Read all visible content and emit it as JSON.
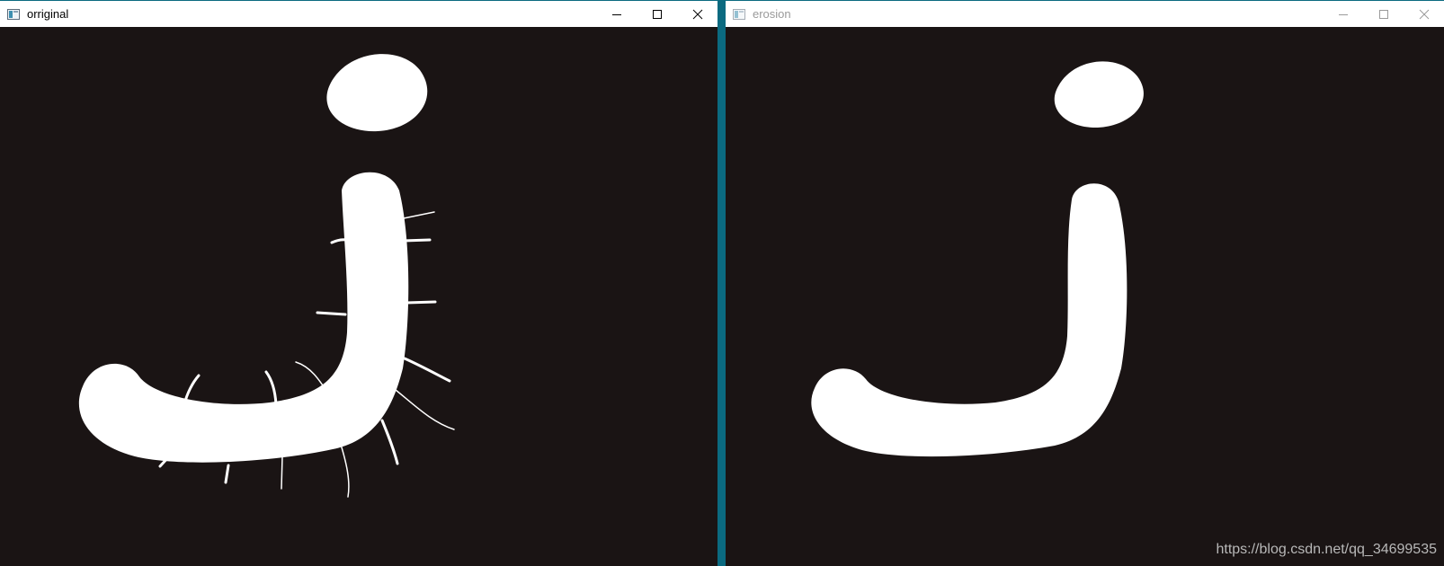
{
  "windows": [
    {
      "id": "left",
      "title": "orriginal",
      "active": true,
      "image": "image-original"
    },
    {
      "id": "right",
      "title": "erosion",
      "active": false,
      "image": "image-erosion"
    }
  ],
  "left_window": {
    "title": "orriginal"
  },
  "right_window": {
    "title": "erosion"
  },
  "watermark": {
    "text": "https://blog.csdn.net/qq_34699535"
  },
  "colors": {
    "desktop": "#0b6a80",
    "image_background": "#1a1414",
    "glyph": "#ffffff",
    "titlebar_active_text": "#000000",
    "titlebar_inactive_text": "#9a9a9a"
  },
  "icons": {
    "minimize": "minimize-icon",
    "maximize": "maximize-icon",
    "close": "close-icon",
    "app": "app-icon"
  }
}
